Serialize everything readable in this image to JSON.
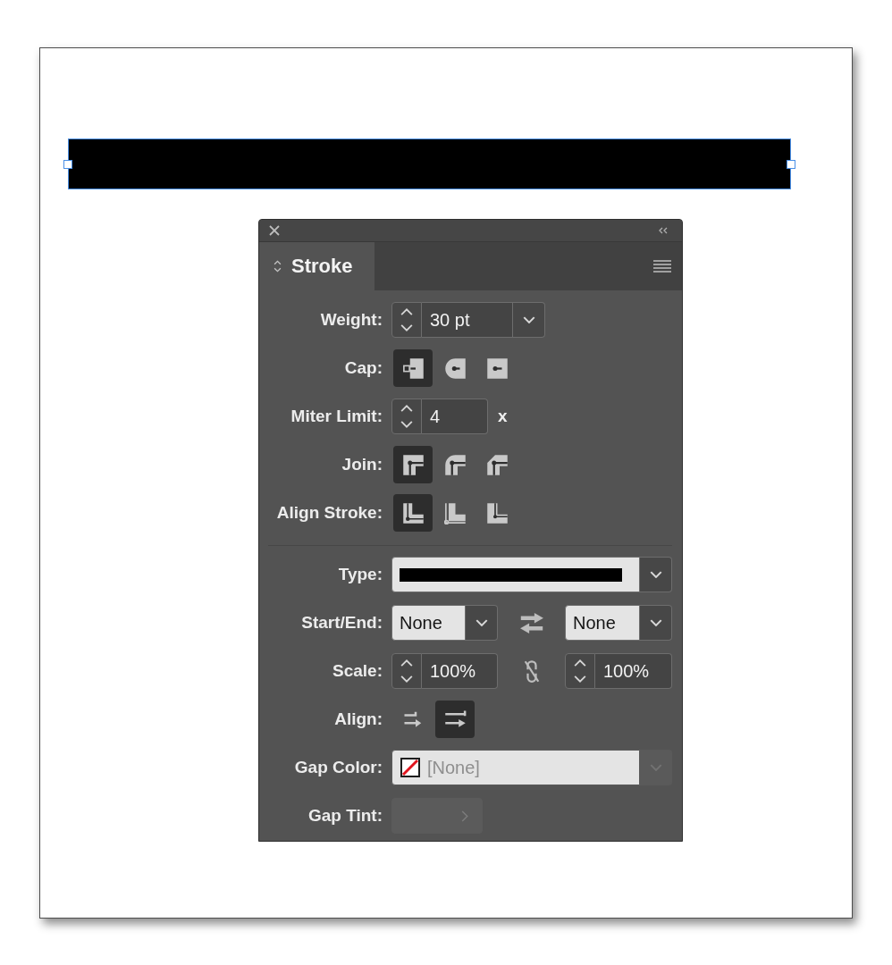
{
  "document": {
    "shape": {
      "selected": true
    }
  },
  "panel": {
    "tabs": [
      {
        "label": "Stroke",
        "selected": true
      }
    ],
    "sections": [
      {
        "rows": [
          {
            "kind": "spinner_menu",
            "label": "Weight:",
            "value": "30 pt"
          },
          {
            "kind": "icons",
            "label": "Cap:",
            "options": [
              {
                "kind": "butt_cap",
                "selected": true
              },
              {
                "kind": "round_cap",
                "selected": false
              },
              {
                "kind": "square_cap",
                "selected": false
              }
            ]
          },
          {
            "kind": "spinner",
            "label": "Miter Limit:",
            "value": "4",
            "unit": "x"
          },
          {
            "kind": "icons",
            "label": "Join:",
            "options": [
              {
                "kind": "miter_join",
                "selected": true
              },
              {
                "kind": "round_join",
                "selected": false
              },
              {
                "kind": "bevel_join",
                "selected": false
              }
            ]
          },
          {
            "kind": "icons",
            "label": "Align Stroke:",
            "options": [
              {
                "kind": "center_stroke",
                "selected": true
              },
              {
                "kind": "inside_stroke",
                "selected": false
              },
              {
                "kind": "outside_stroke",
                "selected": false
              }
            ]
          }
        ]
      },
      {
        "rows": [
          {
            "kind": "line_menu",
            "label": "Type:"
          },
          {
            "kind": "menu_pair",
            "label": "Start/End:",
            "start": "None",
            "end": "None"
          },
          {
            "kind": "spinner_pair",
            "label": "Scale:",
            "start": "100%",
            "end": "100%",
            "linked": false
          },
          {
            "kind": "icons",
            "label": "Align:",
            "options": [
              {
                "kind": "extend_dash",
                "selected": false
              },
              {
                "kind": "fit_dash",
                "selected": true
              }
            ]
          },
          {
            "kind": "swatch_menu",
            "label": "Gap Color:",
            "value": "[None]",
            "disabled": true
          },
          {
            "kind": "tint",
            "label": "Gap Tint:",
            "disabled": true
          }
        ]
      }
    ]
  }
}
